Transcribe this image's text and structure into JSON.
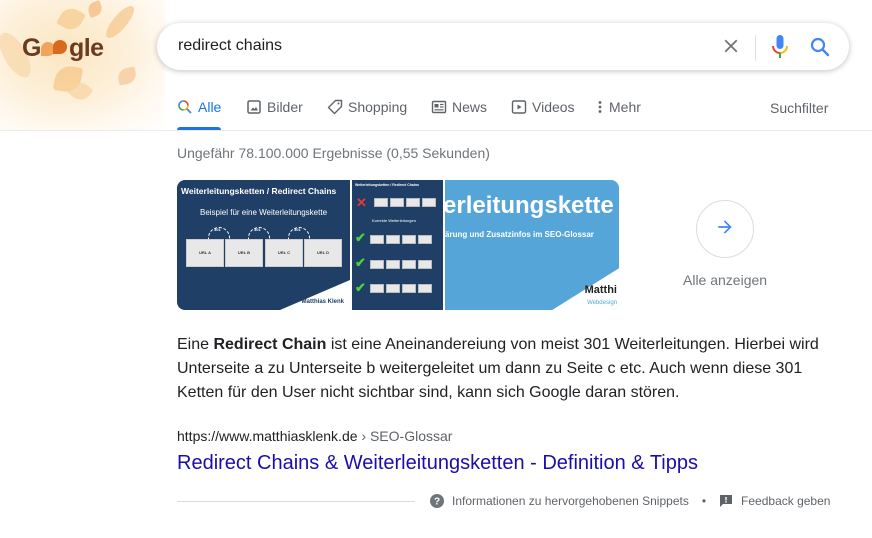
{
  "logo": {
    "text_before": "G",
    "text_after": "gle",
    "alt": "Google Doodle"
  },
  "search": {
    "query": "redirect chains",
    "clear_icon": "close-icon",
    "mic_icon": "microphone-icon",
    "search_icon": "search-icon"
  },
  "tabs": [
    {
      "label": "Alle",
      "icon": "search-icon",
      "active": true
    },
    {
      "label": "Bilder",
      "icon": "image-icon"
    },
    {
      "label": "Shopping",
      "icon": "tag-icon"
    },
    {
      "label": "News",
      "icon": "newspaper-icon"
    },
    {
      "label": "Videos",
      "icon": "play-icon"
    },
    {
      "label": "Mehr",
      "icon": "more-vert-icon"
    }
  ],
  "suchfilter": "Suchfilter",
  "stats": "Ungefähr 78.100.000 Ergebnisse (0,55 Sekunden)",
  "images": {
    "img1": {
      "title": "Weiterleitungsketten / Redirect Chains",
      "subtitle": "Beispiel für eine Weiterleitungskette",
      "redirect_code": "301",
      "urls": [
        "URL A",
        "URL B",
        "URL C",
        "URL D"
      ],
      "brand": "Matthias Klenk"
    },
    "img2": {
      "title": "Weiterleitungsketten / Redirect Chains",
      "subtitle": "Korrekte Weiterleitungen"
    },
    "img3": {
      "title": "erleitungskette",
      "subtitle": "ärung und Zusatzinfos im SEO-Glossar",
      "brand": "Matthi",
      "brand_sub": "Webdesign"
    },
    "show_all_label": "Alle anzeigen"
  },
  "snippet": {
    "prefix": "Eine ",
    "bold": "Redirect Chain",
    "rest": " ist eine Aneinandereiung von meist 301 Weiterleitungen. Hierbei wird Unterseite a zu Unterseite b weitergeleitet um dann zu Seite c etc. Auch wenn diese 301 Ketten für den User nicht sichtbar sind, kann sich Google daran stören."
  },
  "result": {
    "url": "https://www.matthiasklenk.de",
    "breadcrumb": " › SEO-Glossar",
    "title": "Redirect Chains & Weiterleitungsketten - Definition & Tipps"
  },
  "footer": {
    "info_label": "Informationen zu hervorgehobenen Snippets",
    "separator": "•",
    "feedback_label": "Feedback geben"
  },
  "colors": {
    "accent": "#1a73e8",
    "link": "#1a0dab",
    "muted": "#70757a"
  }
}
